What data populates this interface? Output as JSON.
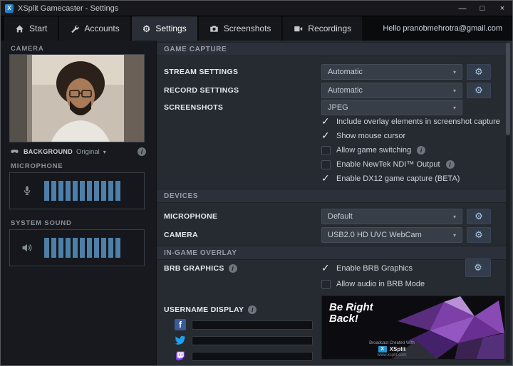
{
  "window": {
    "title": "XSplit Gamecaster - Settings"
  },
  "icons": {
    "logo_letter": "X",
    "minimize": "—",
    "maximize": "□",
    "close": "×",
    "chevron_down": "▾",
    "gear": "⚙",
    "info": "i",
    "facebook_letter": "f"
  },
  "nav": {
    "tabs": [
      {
        "label": "Start"
      },
      {
        "label": "Accounts"
      },
      {
        "label": "Settings"
      },
      {
        "label": "Screenshots"
      },
      {
        "label": "Recordings"
      }
    ],
    "greeting": "Hello pranobmehrotra@gmail.com"
  },
  "sidebar": {
    "camera": {
      "label": "CAMERA"
    },
    "background": {
      "label": "BACKGROUND",
      "value": "Original"
    },
    "microphone": {
      "label": "MICROPHONE"
    },
    "system_sound": {
      "label": "SYSTEM SOUND"
    }
  },
  "settings": {
    "game_capture": {
      "header": "GAME CAPTURE",
      "stream": {
        "label": "STREAM SETTINGS",
        "value": "Automatic"
      },
      "record": {
        "label": "RECORD SETTINGS",
        "value": "Automatic"
      },
      "screenshots": {
        "label": "SCREENSHOTS",
        "value": "JPEG"
      },
      "options": [
        {
          "label": "Include overlay elements in screenshot capture",
          "checked": true
        },
        {
          "label": "Show mouse cursor",
          "checked": true
        },
        {
          "label": "Allow game switching",
          "checked": false
        },
        {
          "label": "Enable NewTek NDI™ Output",
          "checked": false
        },
        {
          "label": "Enable DX12 game capture (BETA)",
          "checked": true
        }
      ]
    },
    "devices": {
      "header": "DEVICES",
      "microphone": {
        "label": "MICROPHONE",
        "value": "Default"
      },
      "camera": {
        "label": "CAMERA",
        "value": "USB2.0 HD UVC WebCam"
      }
    },
    "overlay": {
      "header": "IN-GAME OVERLAY",
      "brb": {
        "label": "BRB GRAPHICS"
      },
      "brb_options": [
        {
          "label": "Enable BRB Graphics",
          "checked": true
        },
        {
          "label": "Allow audio in BRB Mode",
          "checked": false
        }
      ],
      "username_display": {
        "label": "USERNAME DISPLAY"
      },
      "brb_preview": {
        "title": "Be Right Back!",
        "caption": "Broadcast Created With",
        "brand": "XSplit",
        "url": "www.xsplit.com"
      }
    }
  },
  "colors": {
    "accent_blue": "#4d7fa8",
    "facebook": "#3a5a98",
    "twitter": "#1da1f2",
    "twitch": "#9146ff"
  }
}
